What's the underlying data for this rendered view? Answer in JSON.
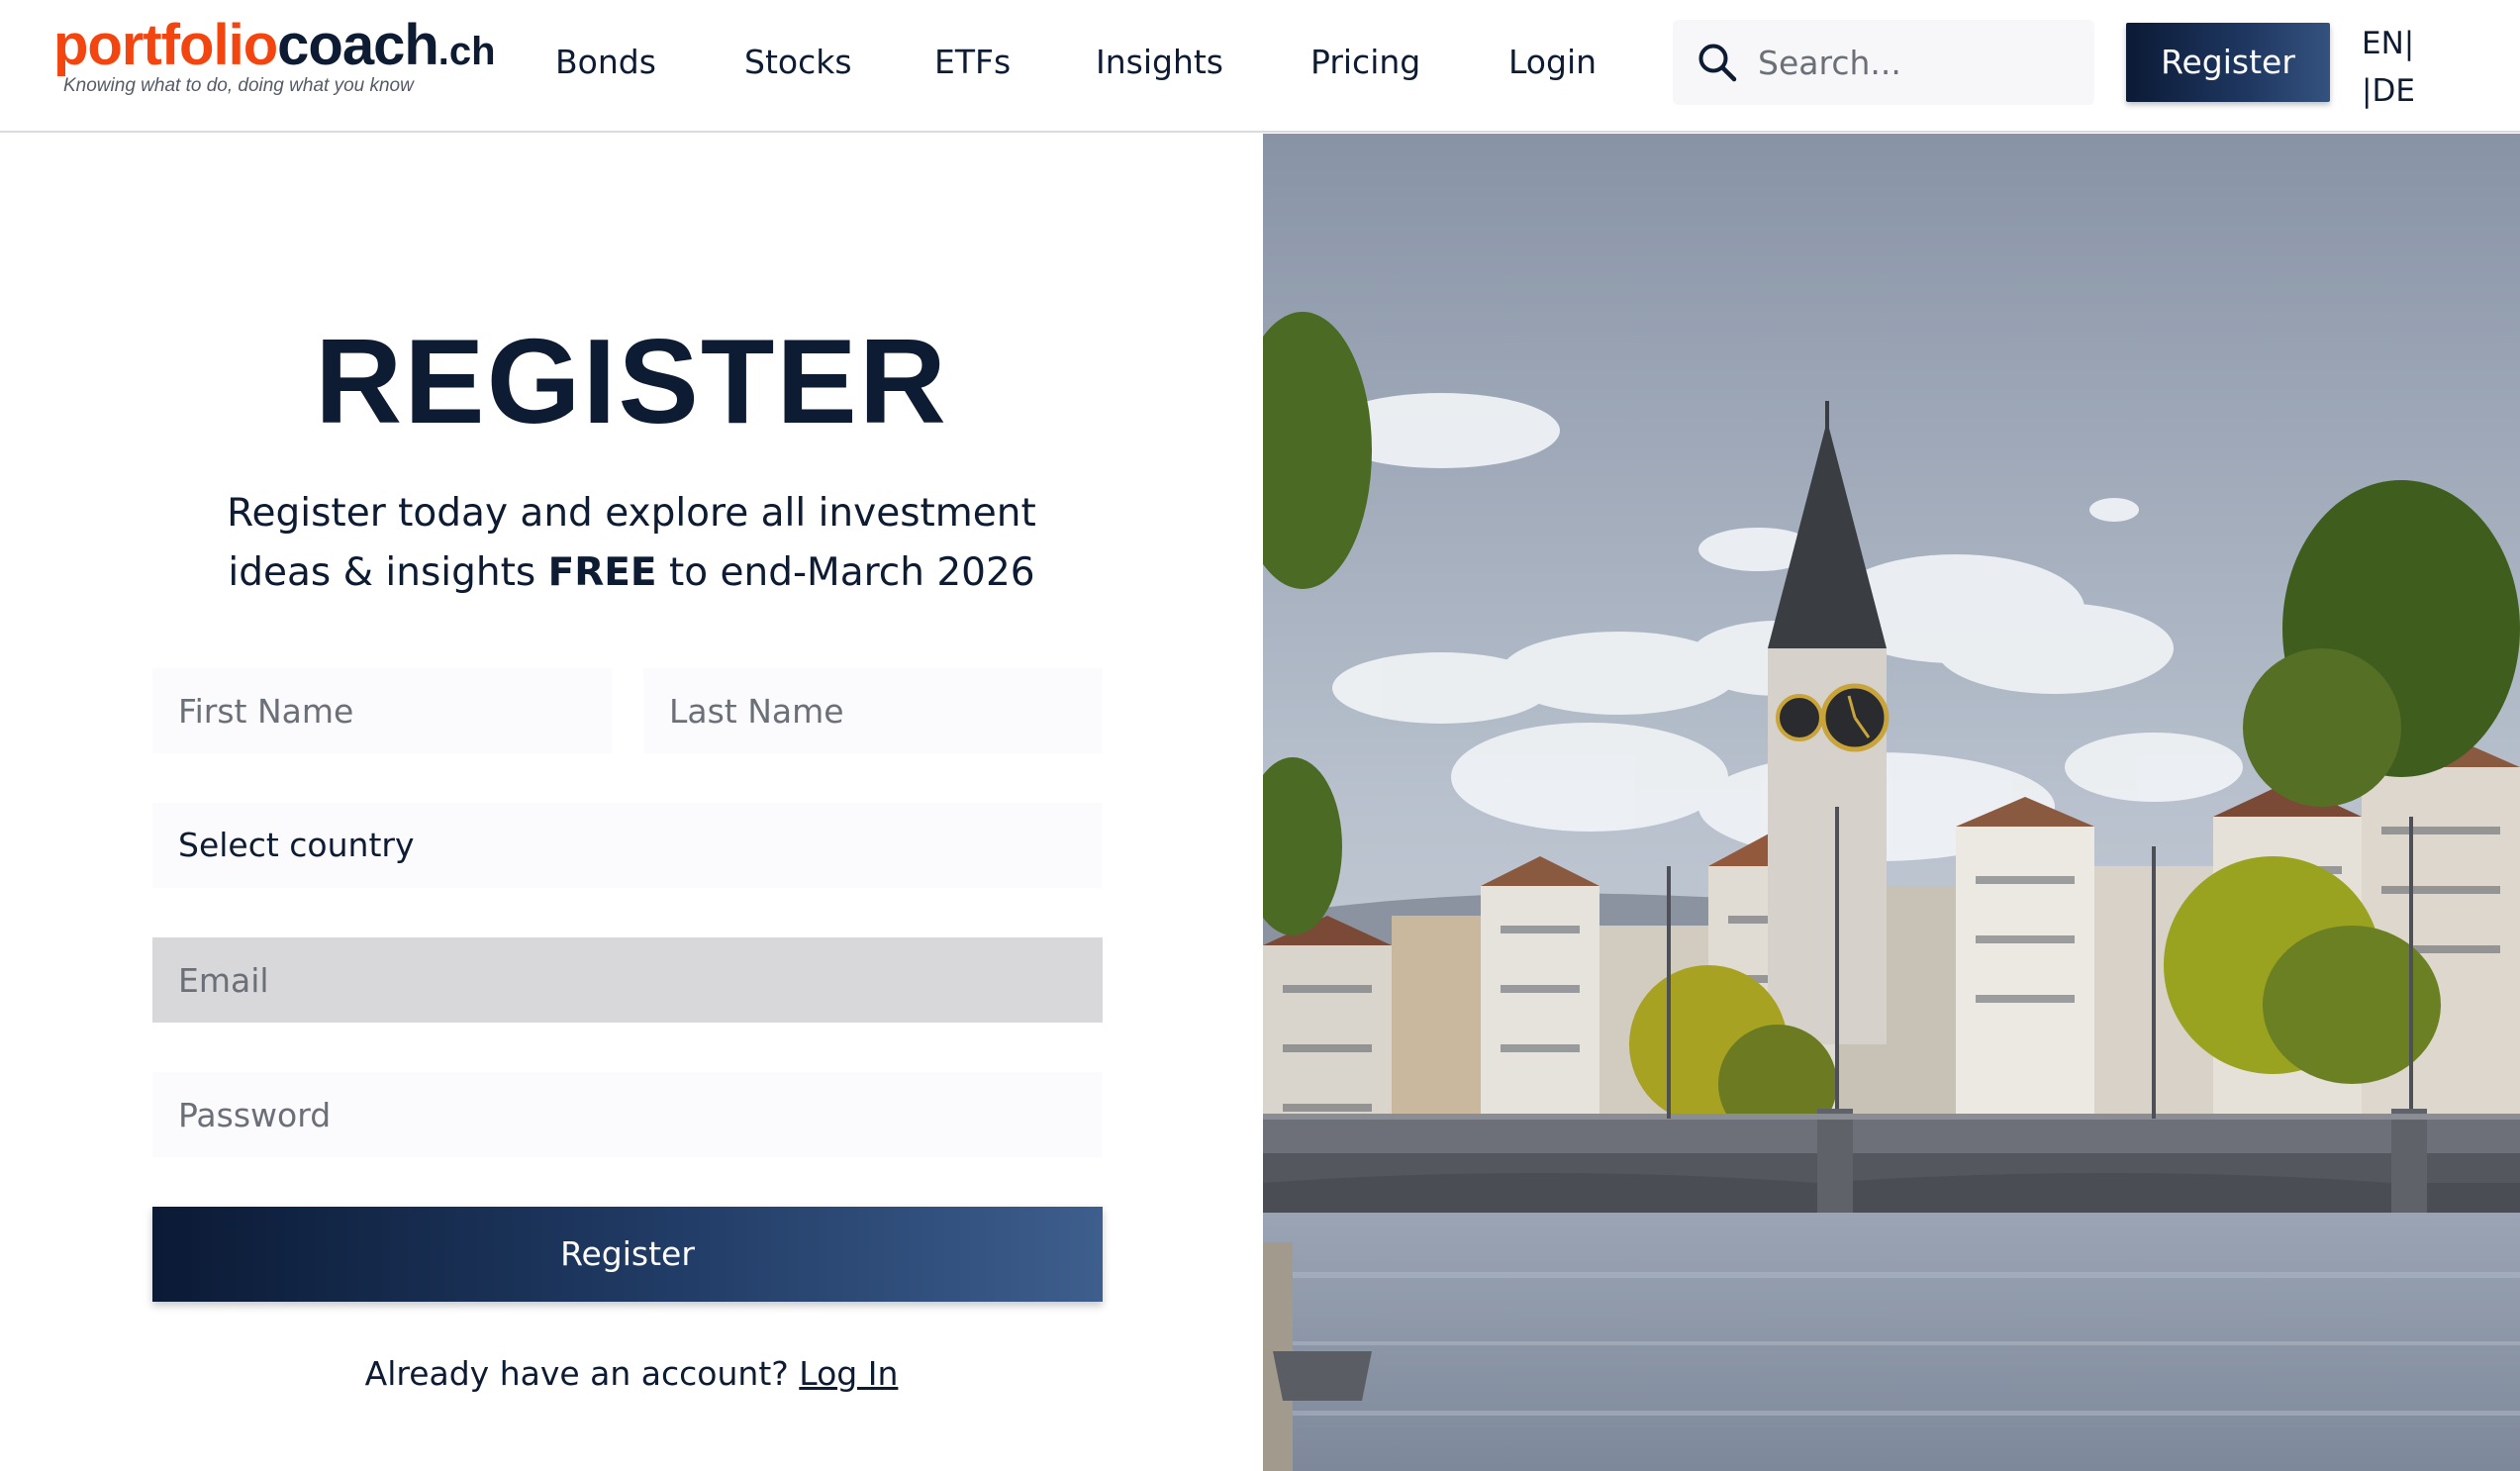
{
  "header": {
    "logo": {
      "part1": "portfolio",
      "part2": "coach",
      "part3": ".ch",
      "tagline": "Knowing what to do, doing what you know"
    },
    "nav": [
      "Bonds",
      "Stocks",
      "ETFs",
      "Insights",
      "Pricing",
      "Login"
    ],
    "search": {
      "placeholder": "Search...",
      "icon": "search-icon"
    },
    "register_label": "Register",
    "languages": {
      "en": "EN",
      "de": "DE"
    }
  },
  "form": {
    "title": "REGISTER",
    "subtitle_line1": "Register today and explore all investment",
    "subtitle_pre": "ideas & insights ",
    "subtitle_bold": "FREE",
    "subtitle_post": " to end-March 2026",
    "first_name_placeholder": "First Name",
    "last_name_placeholder": "Last Name",
    "country_value": "Select country",
    "email_placeholder": "Email",
    "password_placeholder": "Password",
    "submit_label": "Register",
    "have_account_text": "Already have an account?",
    "login_link": "Log In"
  },
  "colors": {
    "brand_orange": "#f2450f",
    "brand_navy": "#0d1b33",
    "button_gradient_start": "#0b1a35",
    "button_gradient_end": "#3e5e8d"
  }
}
